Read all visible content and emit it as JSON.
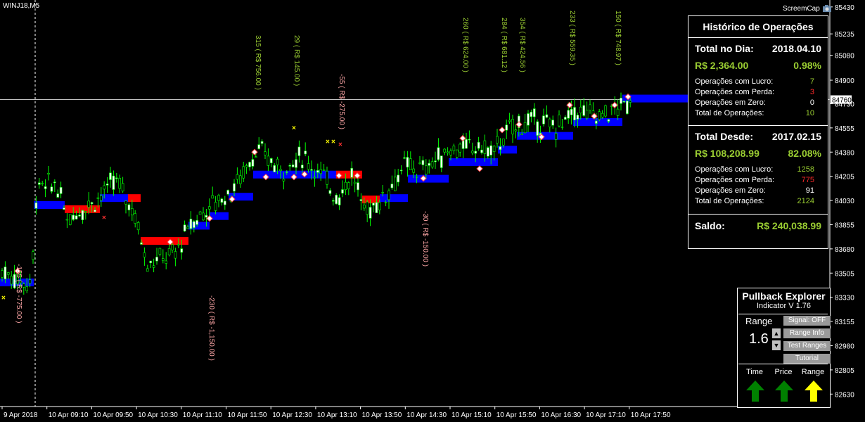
{
  "chart": {
    "symbol": "WINJ18,M5",
    "screencap_label": "ScreemCap",
    "current_price_label": "84760"
  },
  "chart_data": {
    "type": "candlestick",
    "y_ticks": [
      "85430",
      "85235",
      "85080",
      "84900",
      "84730",
      "84555",
      "84380",
      "84205",
      "84030",
      "83855",
      "83680",
      "83505",
      "83330",
      "83155",
      "82980",
      "82805",
      "82630"
    ],
    "x_ticks": [
      "9 Apr 2018",
      "10 Apr 09:10",
      "10 Apr 09:50",
      "10 Apr 10:30",
      "10 Apr 11:10",
      "10 Apr 11:50",
      "10 Apr 12:30",
      "10 Apr 13:10",
      "10 Apr 13:50",
      "10 Apr 14:30",
      "10 Apr 15:10",
      "10 Apr 15:50",
      "10 Apr 16:30",
      "10 Apr 17:10",
      "10 Apr 17:50"
    ],
    "ylim": [
      82540,
      85480
    ],
    "current_price": 84760,
    "trade_annotations": [
      {
        "text": "-155 ( R$ -775.00 )",
        "color": "#ffa7a7"
      },
      {
        "text": "-230 ( R$ -1,150.00 )",
        "color": "#ffa7a7"
      },
      {
        "text": "315 ( R$ 756.00 )",
        "color": "#9acd32"
      },
      {
        "text": "29 ( R$ 145.00 )",
        "color": "#9acd32"
      },
      {
        "text": "-55 ( R$ -275.00 )",
        "color": "#ffa7a7"
      },
      {
        "text": "-30 ( R$ -150.00 )",
        "color": "#ffa7a7"
      },
      {
        "text": "260 ( R$ 624.00 )",
        "color": "#9acd32"
      },
      {
        "text": "284 ( R$ 681.12 )",
        "color": "#9acd32"
      },
      {
        "text": "354 ( R$ 424.56 )",
        "color": "#9acd32"
      },
      {
        "text": "233 ( R$ 559.35 )",
        "color": "#9acd32"
      },
      {
        "text": "150 ( R$ 748.97 )",
        "color": "#9acd32"
      }
    ],
    "trend_band_colors": {
      "up": "#0000ff",
      "down": "#ff0000"
    },
    "candle_colors": {
      "bull": "#ffffff",
      "bear": "#000000",
      "wick": "#00ff00"
    }
  },
  "historico": {
    "title": "Histórico de Operações",
    "day_label": "Total no Dia:",
    "day_date": "2018.04.10",
    "day_value": "R$ 2,364.00",
    "day_pct": "0.98%",
    "day_stats": [
      {
        "label": "Operações com Lucro:",
        "value": "7",
        "color": "#9acd32"
      },
      {
        "label": "Operações com Perda:",
        "value": "3",
        "color": "#ff2a2a"
      },
      {
        "label": "Operações em Zero:",
        "value": "0",
        "color": "#ffffff"
      },
      {
        "label": "Total de Operações:",
        "value": "10",
        "color": "#9acd32"
      }
    ],
    "since_label": "Total Desde:",
    "since_date": "2017.02.15",
    "since_value": "R$ 108,208.99",
    "since_pct": "82.08%",
    "since_stats": [
      {
        "label": "Operações com Lucro:",
        "value": "1258",
        "color": "#9acd32"
      },
      {
        "label": "Operações com Perda:",
        "value": "775",
        "color": "#ff2a2a"
      },
      {
        "label": "Operações em Zero:",
        "value": "91",
        "color": "#ffffff"
      },
      {
        "label": "Total de Operações:",
        "value": "2124",
        "color": "#9acd32"
      }
    ],
    "saldo_label": "Saldo:",
    "saldo_value": "R$ 240,038.99"
  },
  "pullback": {
    "title": "Pullback Explorer",
    "subtitle": "Indicator V 1.76",
    "range_label": "Range",
    "range_value": "1.6",
    "buttons": [
      "Signal: OFF",
      "Range Info",
      "Test Ranges",
      "Tutorial"
    ],
    "bottom_labels": [
      "Time",
      "Price",
      "Range"
    ],
    "arrow_colors": [
      "#008000",
      "#008000",
      "#ffff00"
    ]
  }
}
